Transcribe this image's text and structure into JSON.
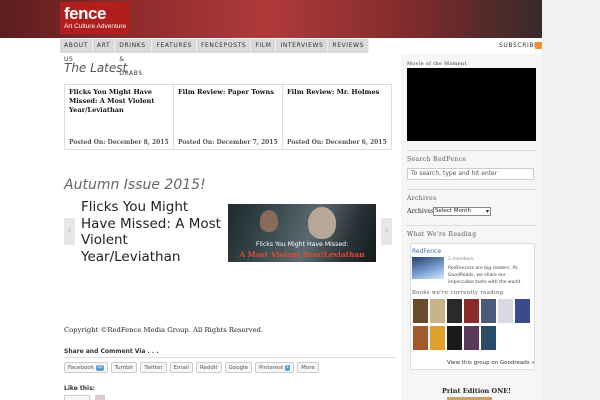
{
  "logo": {
    "word": "fence",
    "tagline": "Art Culture Adventure"
  },
  "nav": {
    "items": [
      "ABOUT US",
      "ART",
      "DRINKS & DRABS",
      "FEATURES",
      "FENCEPOSTS",
      "FILM",
      "INTERVIEWS",
      "REVIEWS"
    ],
    "subscribe": "SUBSCRIBE"
  },
  "latest": {
    "title": "The Latest",
    "cards": [
      {
        "title": "Flicks You Might Have Missed: A Most Violent Year/Leviathan",
        "date": "Posted On: December 8, 2015"
      },
      {
        "title": "Film Review: Paper Towns",
        "date": "Posted On: December 7, 2015"
      },
      {
        "title": "Film Review: Mr. Holmes",
        "date": "Posted On: December 6, 2015"
      }
    ]
  },
  "issue": {
    "title": "Autumn Issue 2015!",
    "slide_title": "Flicks You Might Have Missed: A Most Violent Year/Leviathan",
    "caption_line1": "Flicks You Might Have Missed:",
    "caption_line2": "A Most Violent Year/Leviathan",
    "prev": "‹",
    "next": "›"
  },
  "footer": {
    "copyright": "Copyright ©RedFence Media Group. All Rights Reserved.",
    "share_heading": "Share and Comment Via . . .",
    "share_buttons": [
      {
        "label": "Facebook",
        "count": "50"
      },
      {
        "label": "Tumblr"
      },
      {
        "label": "Twitter"
      },
      {
        "label": "Email"
      },
      {
        "label": "Reddit"
      },
      {
        "label": "Google"
      },
      {
        "label": "Pinterest",
        "count": "1"
      },
      {
        "label": "More"
      }
    ],
    "like_heading": "Like this:"
  },
  "sidebar": {
    "movie_heading": "Movie of the Moment",
    "search_heading": "Search RedFence",
    "search_placeholder": "To search, type and hit enter",
    "archives_heading": "Archives",
    "archives_label": "Archives",
    "archives_select": "Select Month",
    "reading_heading": "What We're Reading",
    "group_name": "RedFence",
    "group_members": "2 members",
    "group_desc": "RedFencers are big readers. At GoodReads, we share our impeccable taste with the world.",
    "books_heading": "Books we're currently reading",
    "group_link": "View this group on Goodreads »",
    "print_heading": "Print Edition ONE!"
  },
  "colors": {
    "brand_red": "#b11e1e",
    "accent_orange": "#e24a2a",
    "nav_bg": "#d9d9d9"
  }
}
